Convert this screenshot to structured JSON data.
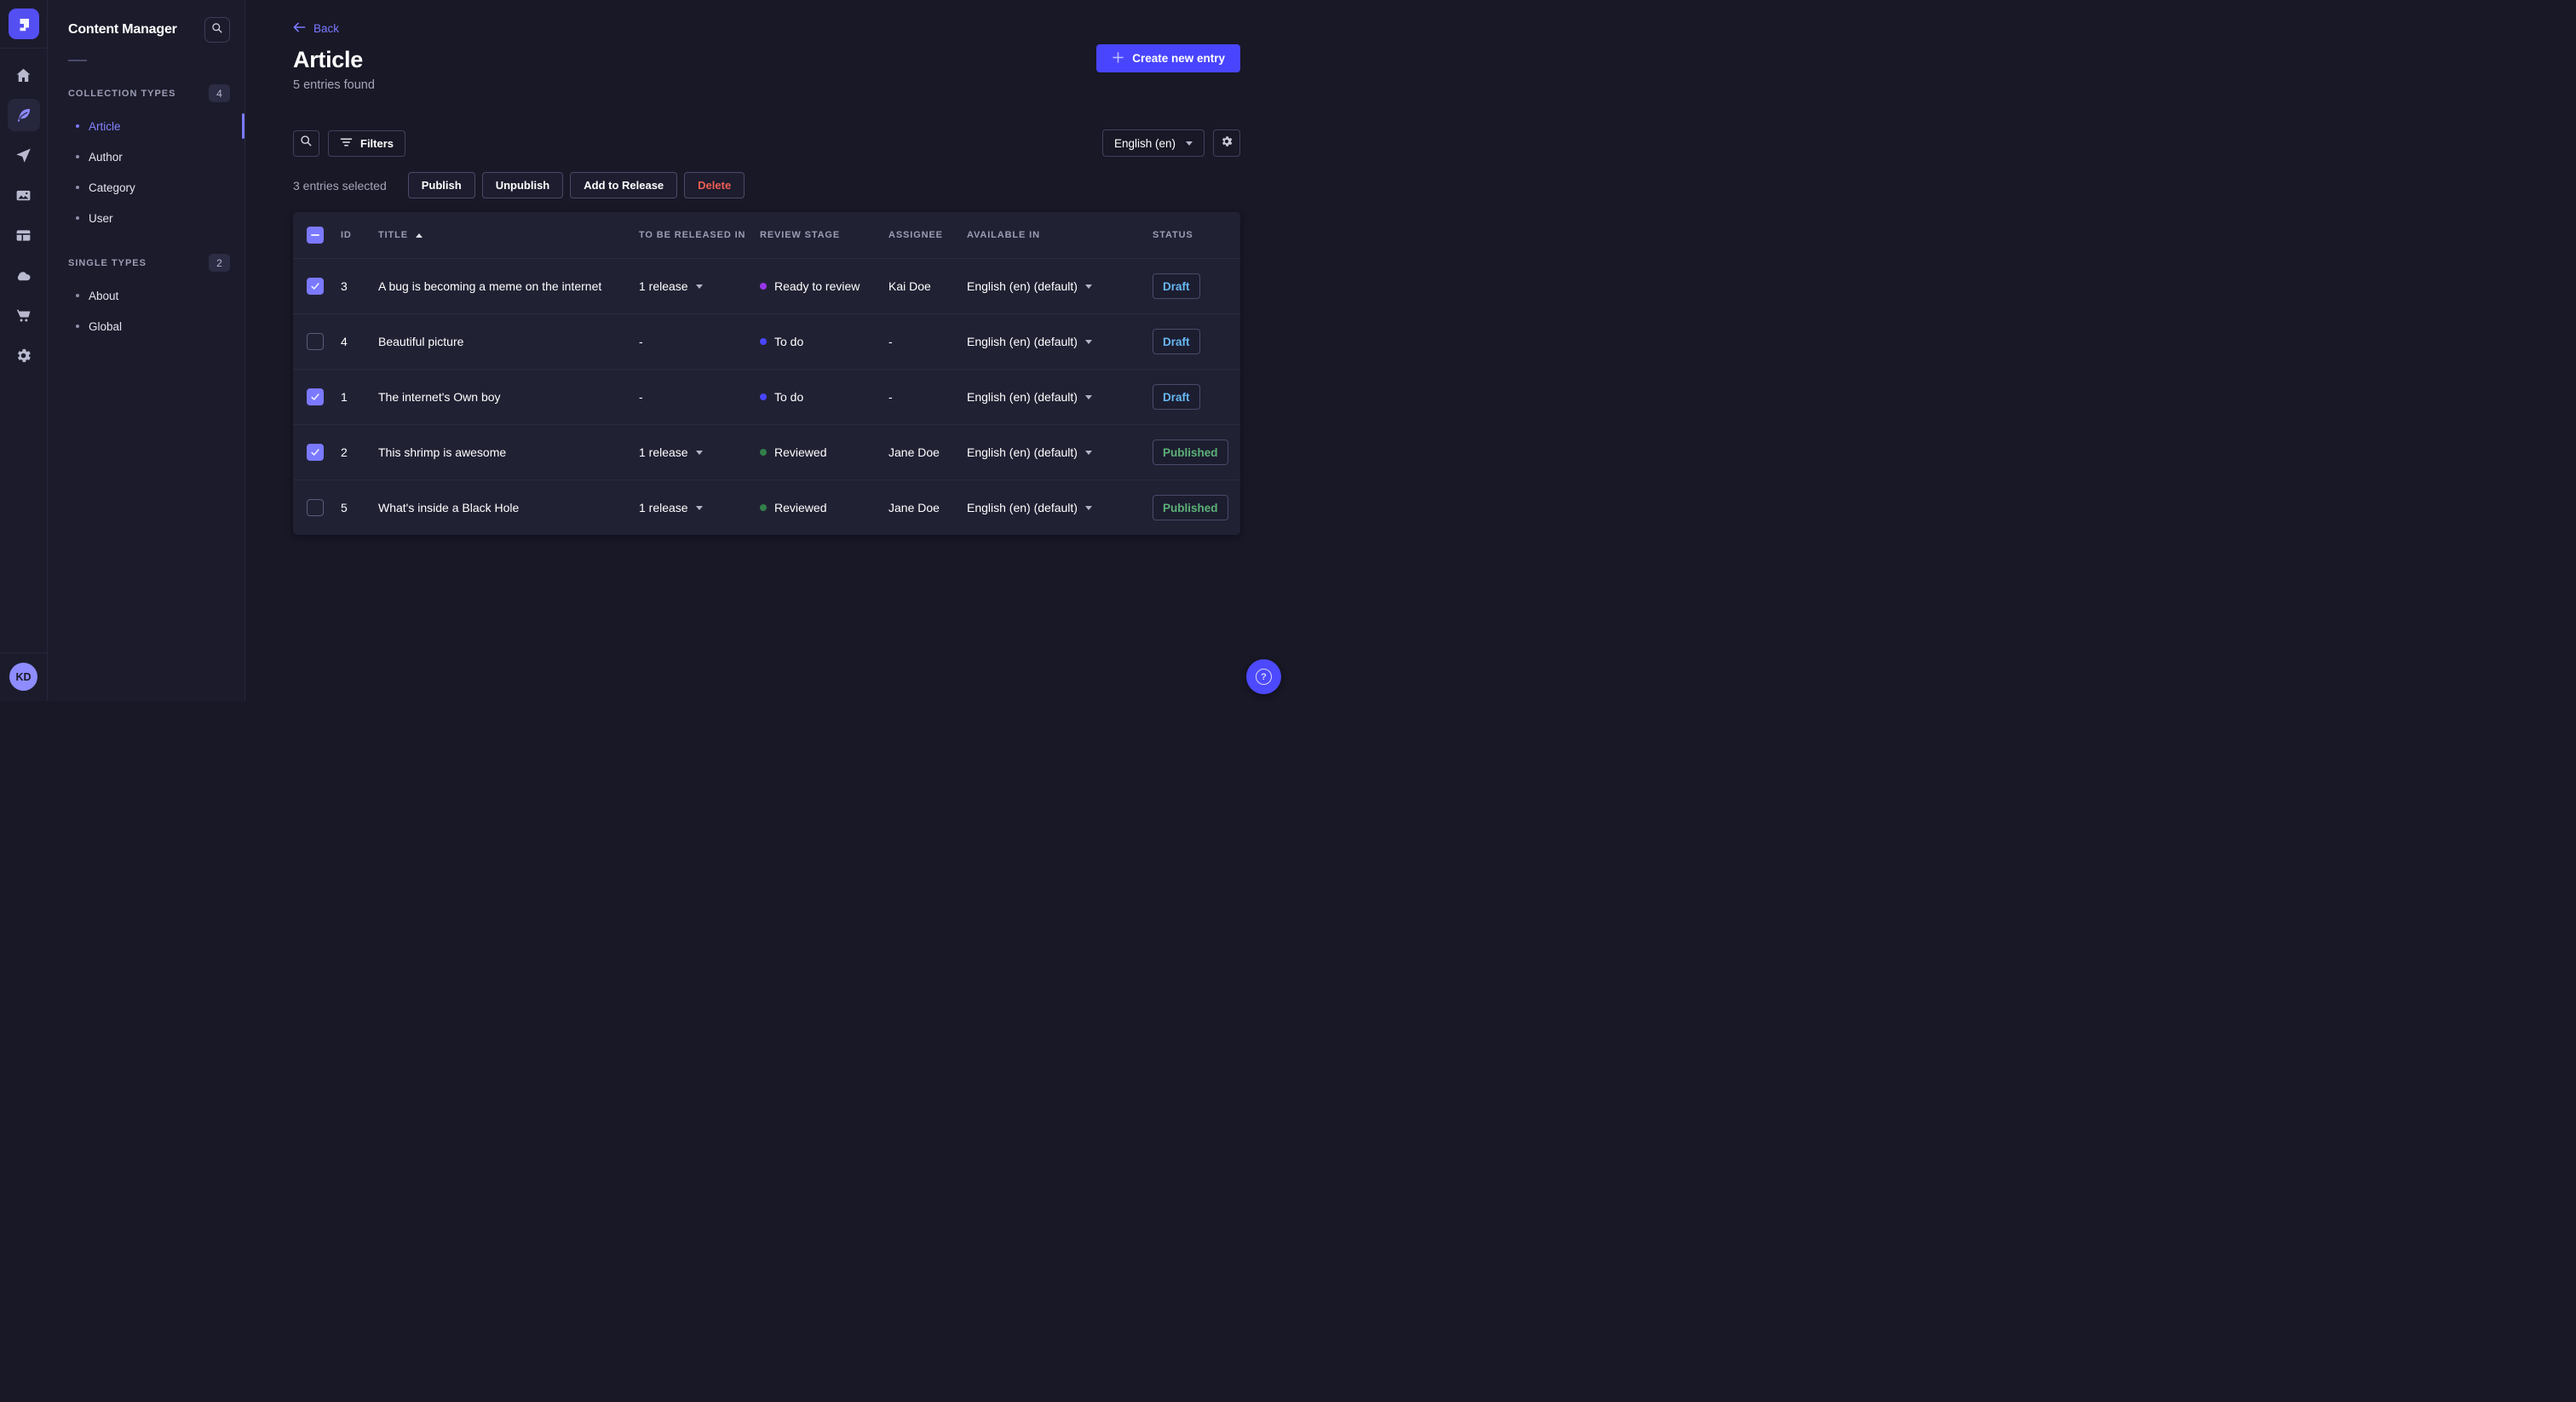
{
  "rail": {
    "items": [
      {
        "name": "home"
      },
      {
        "name": "content-manager",
        "active": true
      },
      {
        "name": "releases"
      },
      {
        "name": "media-library"
      },
      {
        "name": "content-type-builder"
      },
      {
        "name": "deploy"
      },
      {
        "name": "marketplace"
      },
      {
        "name": "settings"
      }
    ],
    "avatar_initials": "KD"
  },
  "panel": {
    "title": "Content Manager",
    "sections": [
      {
        "label": "COLLECTION TYPES",
        "count": "4",
        "items": [
          {
            "label": "Article",
            "active": true
          },
          {
            "label": "Author"
          },
          {
            "label": "Category"
          },
          {
            "label": "User"
          }
        ]
      },
      {
        "label": "SINGLE TYPES",
        "count": "2",
        "items": [
          {
            "label": "About"
          },
          {
            "label": "Global"
          }
        ]
      }
    ]
  },
  "header": {
    "back": "Back",
    "title": "Article",
    "subtitle": "5 entries found",
    "create": "Create new entry"
  },
  "toolbar": {
    "filters": "Filters",
    "locale": "English (en)"
  },
  "selection": {
    "summary": "3 entries selected",
    "actions": {
      "publish": "Publish",
      "unpublish": "Unpublish",
      "add_to_release": "Add to Release",
      "delete": "Delete"
    }
  },
  "table": {
    "columns": {
      "id": "ID",
      "title": "TITLE",
      "release": "TO BE RELEASED IN",
      "stage": "REVIEW STAGE",
      "assignee": "ASSIGNEE",
      "available": "AVAILABLE IN",
      "status": "STATUS"
    },
    "sort_column": "TITLE",
    "sort_direction": "asc",
    "rows": [
      {
        "checked": true,
        "id": "3",
        "title": "A bug is becoming a meme on the internet",
        "release": "1 release",
        "stage": "Ready to review",
        "stage_color": "#9736e8",
        "assignee": "Kai Doe",
        "available": "English (en) (default)",
        "status": "Draft"
      },
      {
        "checked": false,
        "id": "4",
        "title": "Beautiful picture",
        "release": "-",
        "stage": "To do",
        "stage_color": "#4945ff",
        "assignee": "-",
        "available": "English (en) (default)",
        "status": "Draft"
      },
      {
        "checked": true,
        "id": "1",
        "title": "The internet's Own boy",
        "release": "-",
        "stage": "To do",
        "stage_color": "#4945ff",
        "assignee": "-",
        "available": "English (en) (default)",
        "status": "Draft"
      },
      {
        "checked": true,
        "id": "2",
        "title": "This shrimp is awesome",
        "release": "1 release",
        "stage": "Reviewed",
        "stage_color": "#328048",
        "assignee": "Jane Doe",
        "available": "English (en) (default)",
        "status": "Published"
      },
      {
        "checked": false,
        "id": "5",
        "title": "What's inside a Black Hole",
        "release": "1 release",
        "stage": "Reviewed",
        "stage_color": "#328048",
        "assignee": "Jane Doe",
        "available": "English (en) (default)",
        "status": "Published"
      }
    ]
  },
  "colors": {
    "brand": "#4945ff",
    "accent": "#7b79ff",
    "draft": "#66b7f1",
    "published": "#5cb176",
    "danger": "#ee5e52"
  },
  "help_glyph": "?"
}
